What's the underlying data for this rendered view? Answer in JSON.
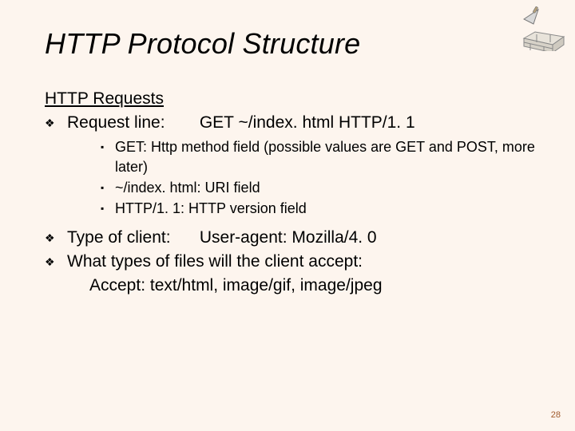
{
  "title": "HTTP Protocol Structure",
  "section_heading": "HTTP Requests",
  "bullets": {
    "request_line": {
      "label": "Request line:",
      "value": "GET ~/index. html HTTP/1. 1"
    },
    "type_client": {
      "label": "Type of client:",
      "value": "User-agent: Mozilla/4. 0"
    },
    "accept": {
      "label": "What types of files will the client accept:",
      "value": "Accept: text/html, image/gif, image/jpeg"
    }
  },
  "sub": {
    "get": "GET: Http method field (possible values are GET and POST, more later)",
    "uri": "~/index. html: URI field",
    "ver": "HTTP/1. 1: HTTP version field"
  },
  "page_number": "28"
}
